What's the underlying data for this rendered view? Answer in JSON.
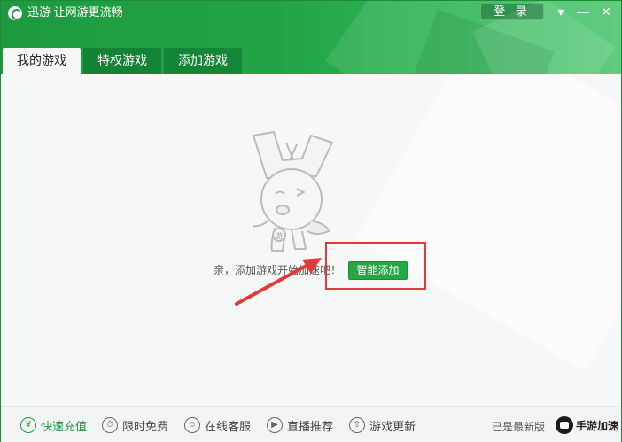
{
  "app": {
    "title": "迅游 让网游更流畅",
    "login_label": "登 录",
    "minimize_label": "▾",
    "minimize_alt": "—",
    "close_label": "✕"
  },
  "tabs": [
    {
      "label": "我的游戏",
      "active": true
    },
    {
      "label": "特权游戏",
      "active": false
    },
    {
      "label": "添加游戏",
      "active": false
    }
  ],
  "main": {
    "hint_text": "亲，添加游戏开始加速吧！",
    "smart_add_label": "智能添加",
    "mascot_badge": "游"
  },
  "footer": {
    "items": [
      {
        "label": "快速充值",
        "icon": "yen-icon",
        "glyph": "¥"
      },
      {
        "label": "限时免费",
        "icon": "timer-icon",
        "glyph": "⏱"
      },
      {
        "label": "在线客服",
        "icon": "user-icon",
        "glyph": "☺"
      },
      {
        "label": "直播推荐",
        "icon": "play-icon",
        "glyph": "▶"
      },
      {
        "label": "游戏更新",
        "icon": "upload-icon",
        "glyph": "⇧"
      }
    ],
    "status": "已是最新版",
    "brand": "手游加速"
  },
  "colors": {
    "brand_green": "#1d9a40",
    "button_green": "#24a846",
    "highlight_red": "#e23a3a"
  }
}
